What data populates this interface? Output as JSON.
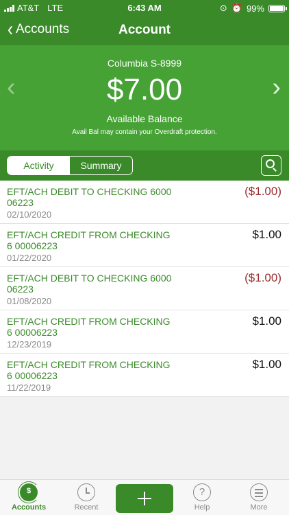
{
  "status": {
    "carrier": "AT&T",
    "network": "LTE",
    "time": "6:43 AM",
    "battery": "99%",
    "battery_level": 0.99
  },
  "nav": {
    "back_label": "Accounts",
    "title": "Account"
  },
  "account": {
    "name": "Columbia S-8999",
    "balance": "$7.00",
    "balance_label": "Available Balance",
    "note": "Avail Bal may contain your Overdraft protection."
  },
  "tabs": {
    "activity": "Activity",
    "summary": "Summary"
  },
  "transactions": [
    {
      "desc": "EFT/ACH DEBIT TO CHECKING 6000 06223",
      "date": "02/10/2020",
      "amount": "($1.00)",
      "type": "debit"
    },
    {
      "desc": "EFT/ACH CREDIT FROM CHECKING 6 00006223",
      "date": "01/22/2020",
      "amount": "$1.00",
      "type": "credit"
    },
    {
      "desc": "EFT/ACH DEBIT TO CHECKING 6000 06223",
      "date": "01/08/2020",
      "amount": "($1.00)",
      "type": "debit"
    },
    {
      "desc": "EFT/ACH CREDIT FROM CHECKING 6 00006223",
      "date": "12/23/2019",
      "amount": "$1.00",
      "type": "credit"
    },
    {
      "desc": "EFT/ACH CREDIT FROM CHECKING 6 00006223",
      "date": "11/22/2019",
      "amount": "$1.00",
      "type": "credit"
    }
  ],
  "bottom_tabs": {
    "accounts": "Accounts",
    "recent": "Recent",
    "help": "Help",
    "more": "More"
  },
  "icons": {
    "accounts_glyph": "$",
    "help_glyph": "?"
  },
  "colors": {
    "brand_dark": "#3a8a2a",
    "brand_light": "#47a236",
    "debit": "#9b2c2c"
  }
}
